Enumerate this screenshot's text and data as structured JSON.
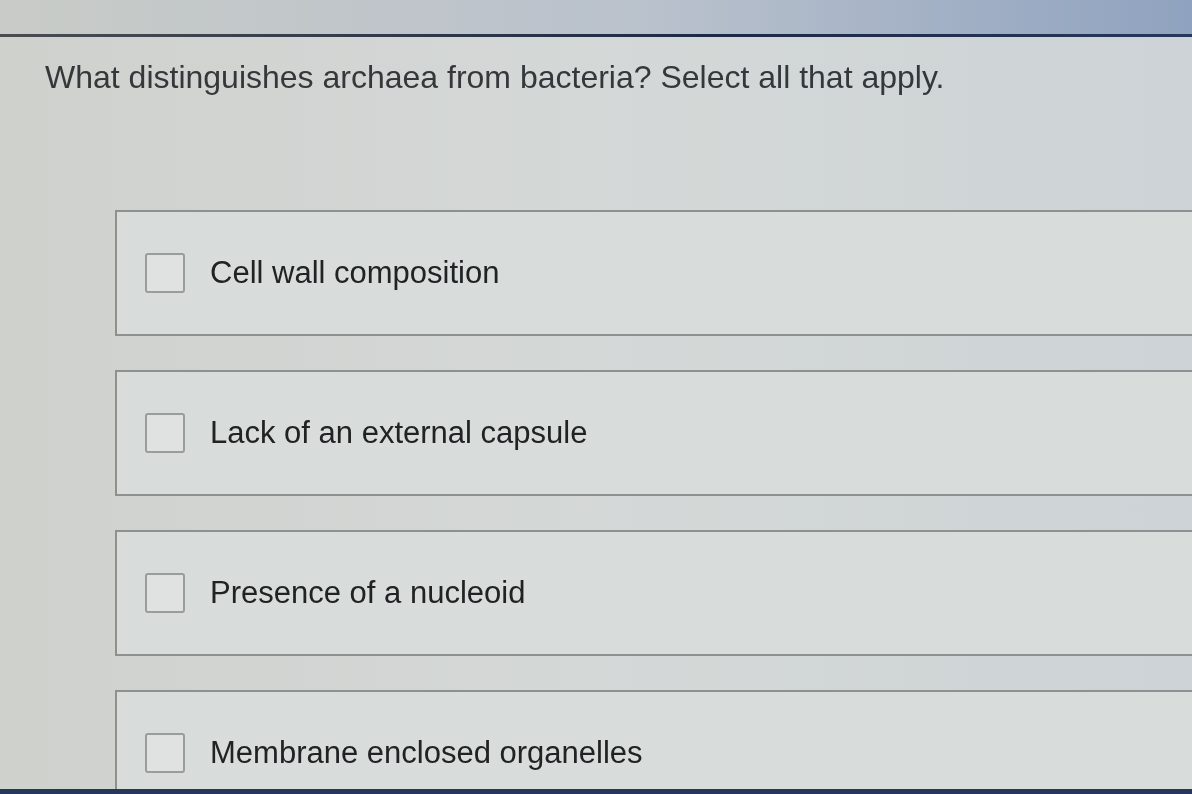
{
  "question": "What distinguishes archaea from bacteria? Select all that apply.",
  "options": [
    {
      "label": "Cell wall composition",
      "checked": false
    },
    {
      "label": "Lack of an external capsule",
      "checked": false
    },
    {
      "label": "Presence of a nucleoid",
      "checked": false
    },
    {
      "label": "Membrane enclosed organelles",
      "checked": false
    }
  ]
}
